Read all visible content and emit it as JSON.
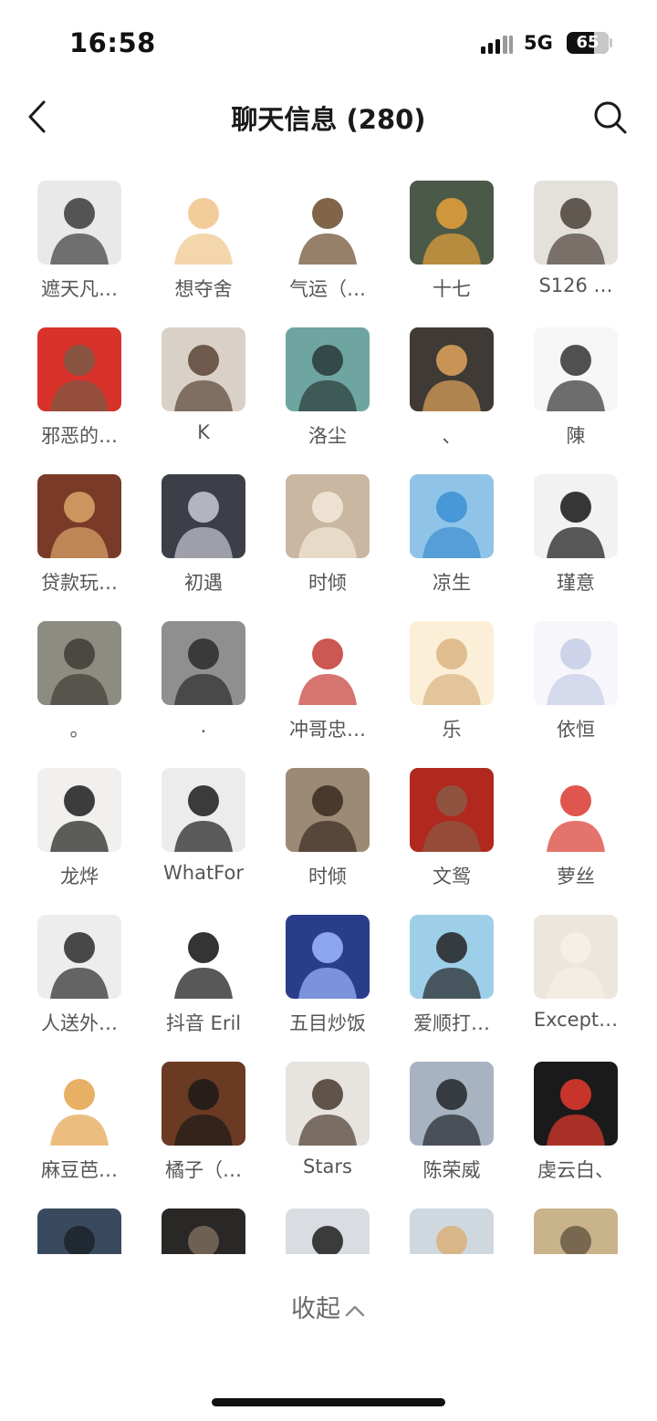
{
  "status_bar": {
    "time": "16:58",
    "network": "5G",
    "battery": "65",
    "battery_level": 0.65,
    "signal_bars": 4
  },
  "nav": {
    "title": "聊天信息 (280)",
    "back_icon": "chevron-left-icon",
    "search_icon": "search-icon"
  },
  "members": [
    {
      "name": "遮天凡…",
      "bg": "#e9e9e9",
      "fg": "#3a3a3a"
    },
    {
      "name": "想夺舍",
      "bg": "#ffffff",
      "fg": "#f0c48a"
    },
    {
      "name": "气运（…",
      "bg": "#ffffff",
      "fg": "#6b4a2b"
    },
    {
      "name": "十七",
      "bg": "#4b5a48",
      "fg": "#e6a13a"
    },
    {
      "name": "S126 …",
      "bg": "#e4e1dc",
      "fg": "#4a4038"
    },
    {
      "name": "邪恶的…",
      "bg": "#d8322b",
      "fg": "#7a5a45"
    },
    {
      "name": "K",
      "bg": "#d9d1c8",
      "fg": "#5a4436"
    },
    {
      "name": "洛尘",
      "bg": "#6fa5a0",
      "fg": "#2a3a38"
    },
    {
      "name": "、",
      "bg": "#3f3a36",
      "fg": "#e0a45a"
    },
    {
      "name": "陳",
      "bg": "#f6f6f6",
      "fg": "#333333"
    },
    {
      "name": "贷款玩…",
      "bg": "#7a3a28",
      "fg": "#d9a66a"
    },
    {
      "name": "初遇",
      "bg": "#3d3f48",
      "fg": "#c9c9d3"
    },
    {
      "name": "时倾",
      "bg": "#c9b7a2",
      "fg": "#f3ead9"
    },
    {
      "name": "凉生",
      "bg": "#8fc4e8",
      "fg": "#3c8fd2"
    },
    {
      "name": "瑾意",
      "bg": "#f2f2f2",
      "fg": "#151515"
    },
    {
      "name": "。",
      "bg": "#8c8d80",
      "fg": "#3e3c36"
    },
    {
      "name": ".",
      "bg": "#8f8f8f",
      "fg": "#2b2b2b"
    },
    {
      "name": "冲哥忠…",
      "bg": "#ffffff",
      "fg": "#c43a32"
    },
    {
      "name": "乐",
      "bg": "#fbefd8",
      "fg": "#d9b483"
    },
    {
      "name": "依恒",
      "bg": "#f6f6fb",
      "fg": "#c8cde6"
    },
    {
      "name": "龙烨",
      "bg": "#f2f0ee",
      "fg": "#1c1c1c"
    },
    {
      "name": "WhatFor",
      "bg": "#ececec",
      "fg": "#1c1c1c"
    },
    {
      "name": "时倾",
      "bg": "#9c8a76",
      "fg": "#3a2a20"
    },
    {
      "name": "文鸳",
      "bg": "#b1281f",
      "fg": "#8a5a45"
    },
    {
      "name": "萝丝",
      "bg": "#ffffff",
      "fg": "#d8382e"
    },
    {
      "name": "人送外…",
      "bg": "#ededed",
      "fg": "#2a2a2a"
    },
    {
      "name": "抖音 Eril",
      "bg": "#ffffff",
      "fg": "#111111"
    },
    {
      "name": "五目炒饭",
      "bg": "#2a3d8a",
      "fg": "#9fb6ff"
    },
    {
      "name": "爱顺打…",
      "bg": "#9ecfe9",
      "fg": "#222222"
    },
    {
      "name": "Except…",
      "bg": "#ede6dc",
      "fg": "#f6f0e6"
    },
    {
      "name": "麻豆芭…",
      "bg": "#ffffff",
      "fg": "#e3a24a"
    },
    {
      "name": "橘子（…",
      "bg": "#6b3a22",
      "fg": "#1c1a18"
    },
    {
      "name": "Stars",
      "bg": "#e7e3de",
      "fg": "#4a3a30"
    },
    {
      "name": "陈荣威",
      "bg": "#a7b3c0",
      "fg": "#22262c"
    },
    {
      "name": "虔云白、",
      "bg": "#1a1a1a",
      "fg": "#e63b2e"
    },
    {
      "name": "",
      "bg": "#3a4a5e",
      "fg": "#1c222a"
    },
    {
      "name": "",
      "bg": "#2a2826",
      "fg": "#7a6a5c"
    },
    {
      "name": "",
      "bg": "#d9dde2",
      "fg": "#1f1f1f"
    },
    {
      "name": "",
      "bg": "#cfd8df",
      "fg": "#d9b07a"
    },
    {
      "name": "",
      "bg": "#c9b38a",
      "fg": "#6a5a44"
    }
  ],
  "collapse": {
    "label": "收起",
    "icon": "chevron-up-icon"
  }
}
